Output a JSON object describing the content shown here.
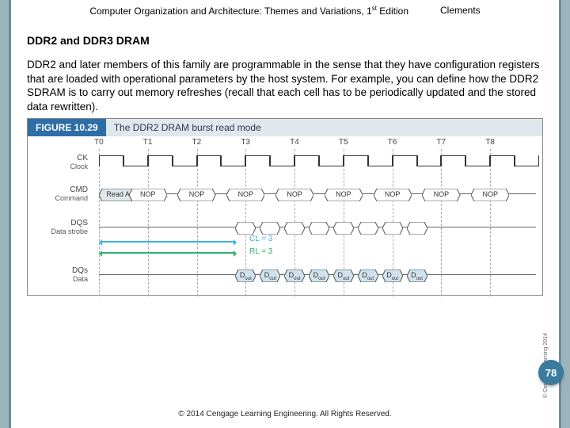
{
  "header": {
    "book_title_html": "Computer Organization and Architecture: Themes and Variations, 1",
    "edition_suffix": "st",
    "edition_word": " Edition",
    "author": "Clements"
  },
  "section_title": "DDR2 and DDR3 DRAM",
  "body_text": "DDR2 and later members of this family are programmable in the sense that they have configuration registers that are loaded with operational parameters by the host system. For example, you can define how the DDR2 SDRAM is to carry out memory refreshes (recall that each cell has to be periodically updated and the stored data rewritten).",
  "figure": {
    "number": "FIGURE 10.29",
    "caption": "The DDR2 DRAM burst read mode",
    "ticks": [
      "T0",
      "T1",
      "T2",
      "T3",
      "T4",
      "T5",
      "T6",
      "T7",
      "T8"
    ],
    "rows": {
      "clock": {
        "label": "CK",
        "sublabel": "Clock"
      },
      "cmd": {
        "label": "CMD",
        "sublabel": "Command",
        "cells": [
          "Read A",
          "NOP",
          "NOP",
          "NOP",
          "NOP",
          "NOP",
          "NOP",
          "NOP",
          "NOP"
        ]
      },
      "dqs": {
        "label": "DQS",
        "sublabel": "Data strobe"
      },
      "dq": {
        "label": "DQs",
        "sublabel": "Data",
        "cells": [
          "D_out",
          "D_out",
          "D_out",
          "D_out",
          "D_out",
          "D_out",
          "D_out",
          "D_out"
        ]
      }
    },
    "annotations": {
      "cl": "CL = 3",
      "rl": "RL = 3"
    },
    "side_copyright": "© Cengage Learning 2014"
  },
  "page_number": "78",
  "footer": "© 2014 Cengage Learning Engineering. All Rights Reserved."
}
